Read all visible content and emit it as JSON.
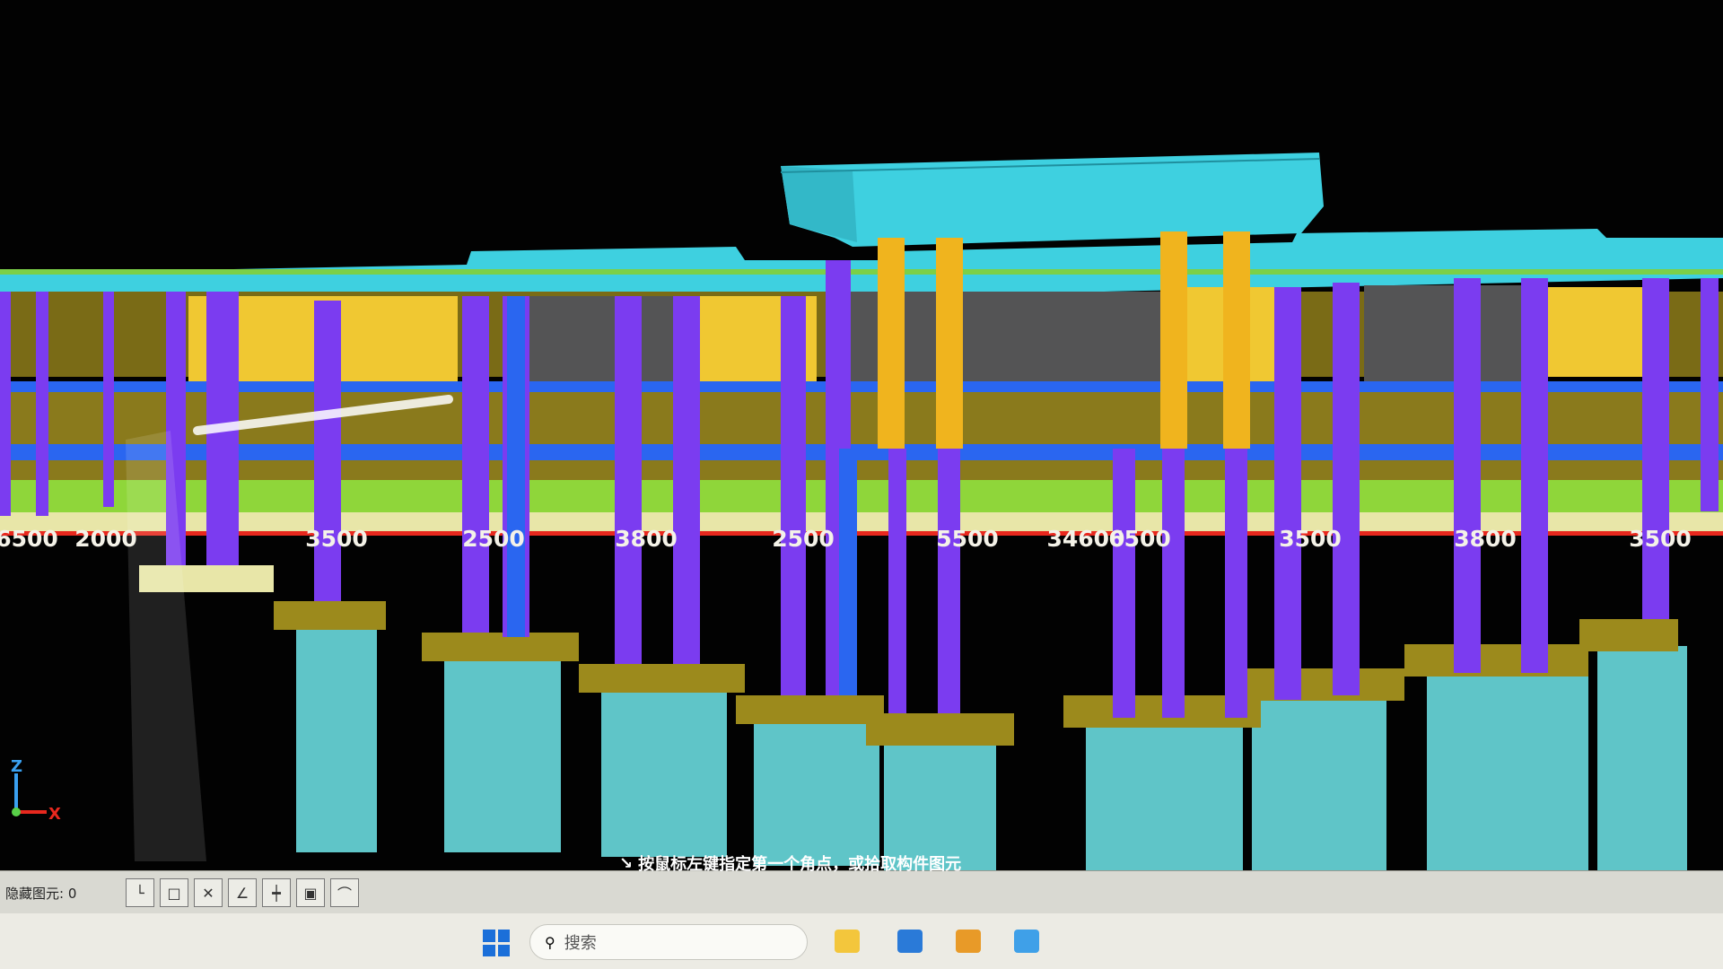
{
  "viewport": {
    "dimension_labels": [
      "6500",
      "2000",
      "3500",
      "2500",
      "3800",
      "2500",
      "5500",
      "34600",
      "6500",
      "3500",
      "3800",
      "3500"
    ],
    "axis": {
      "z_label": "Z",
      "x_label": "X"
    },
    "colors": {
      "background": "#020202",
      "cap_beam": "#3ed0e0",
      "wall": "#f0c832",
      "column": "#7b3cf0",
      "tie_beam": "#2a66f0",
      "slab": "#8fd63a",
      "pile_cap": "#9c8a1c",
      "pile": "#5fc5c8",
      "axis_line": "#e8281e"
    }
  },
  "statusbar": {
    "selection_count_label": "隐藏图元: 0",
    "command_prompt": "按鼠标左键指定第一个角点，或拾取构件图元",
    "snap_tools": [
      "corner-snap-icon",
      "box-select-icon",
      "intersection-snap-icon",
      "angle-snap-icon",
      "offset-snap-icon",
      "component-snap-icon",
      "polyline-snap-icon"
    ]
  },
  "taskbar": {
    "search_placeholder": "搜索"
  }
}
